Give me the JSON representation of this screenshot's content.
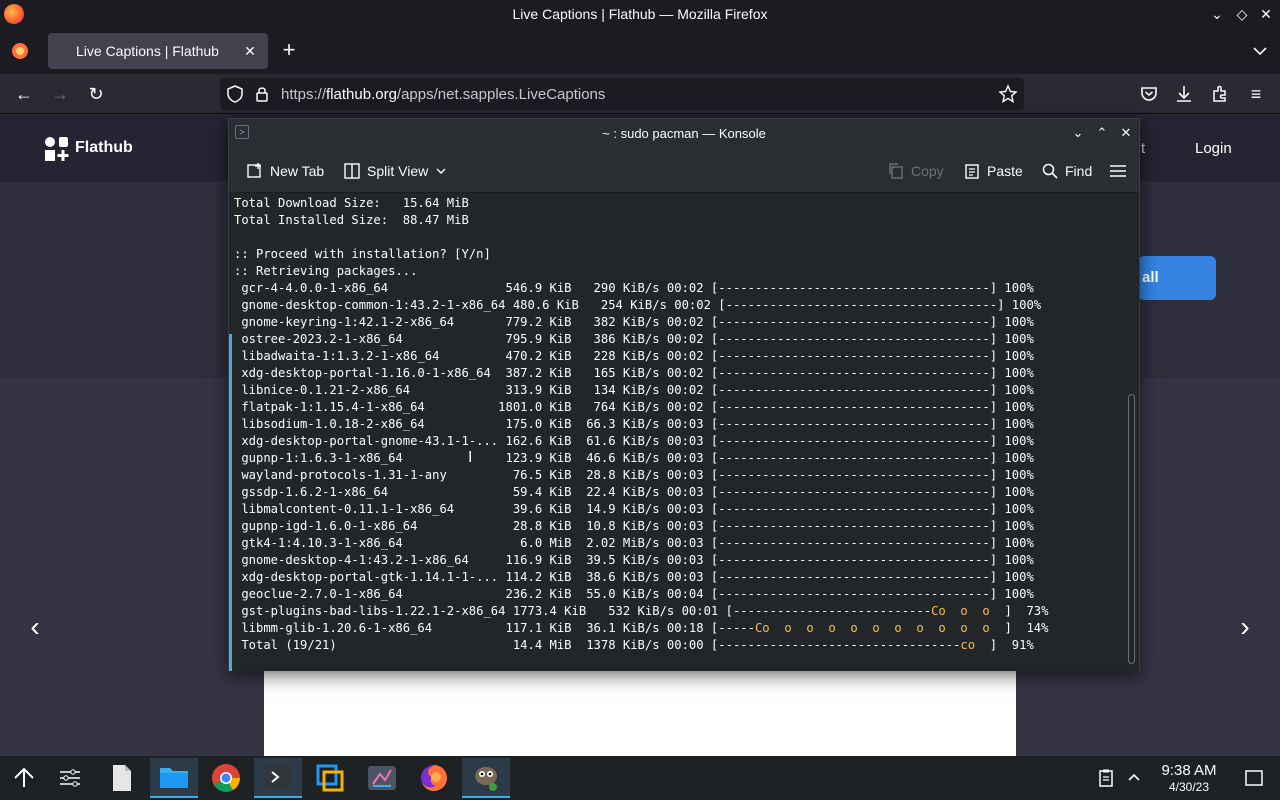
{
  "window": {
    "title": "Live Captions | Flathub — Mozilla Firefox"
  },
  "browser": {
    "tab_label": "Live Captions | Flathub",
    "url_host": "flathub.org",
    "url_prefix": "https://",
    "url_path": "/apps/net.sapples.LiveCaptions"
  },
  "flathub": {
    "logo_text": "Flathub",
    "nav_partial": "t",
    "login": "Login",
    "install_partial": "all"
  },
  "konsole": {
    "title": "~ : sudo pacman — Konsole",
    "toolbar": {
      "new_tab": "New Tab",
      "split_view": "Split View",
      "copy": "Copy",
      "paste": "Paste",
      "find": "Find"
    },
    "lines": [
      "Total Download Size:   15.64 MiB",
      "Total Installed Size:  88.47 MiB",
      "",
      ":: Proceed with installation? [Y/n]",
      ":: Retrieving packages...",
      " gcr-4-4.0.0-1-x86_64                546.9 KiB   290 KiB/s 00:02 [-------------------------------------] 100%",
      " gnome-desktop-common-1:43.2-1-x86_64 480.6 KiB   254 KiB/s 00:02 [-------------------------------------] 100%",
      " gnome-keyring-1:42.1-2-x86_64       779.2 KiB   382 KiB/s 00:02 [-------------------------------------] 100%",
      " ostree-2023.2-1-x86_64              795.9 KiB   386 KiB/s 00:02 [-------------------------------------] 100%",
      " libadwaita-1:1.3.2-1-x86_64         470.2 KiB   228 KiB/s 00:02 [-------------------------------------] 100%",
      " xdg-desktop-portal-1.16.0-1-x86_64  387.2 KiB   165 KiB/s 00:02 [-------------------------------------] 100%",
      " libnice-0.1.21-2-x86_64             313.9 KiB   134 KiB/s 00:02 [-------------------------------------] 100%",
      " flatpak-1:1.15.4-1-x86_64          1801.0 KiB   764 KiB/s 00:02 [-------------------------------------] 100%",
      " libsodium-1.0.18-2-x86_64           175.0 KiB  66.3 KiB/s 00:03 [-------------------------------------] 100%",
      " xdg-desktop-portal-gnome-43.1-1-... 162.6 KiB  61.6 KiB/s 00:03 [-------------------------------------] 100%",
      " gupnp-1:1.6.3-1-x86_64              123.9 KiB  46.6 KiB/s 00:03 [-------------------------------------] 100%",
      " wayland-protocols-1.31-1-any         76.5 KiB  28.8 KiB/s 00:03 [-------------------------------------] 100%",
      " gssdp-1.6.2-1-x86_64                 59.4 KiB  22.4 KiB/s 00:03 [-------------------------------------] 100%",
      " libmalcontent-0.11.1-1-x86_64        39.6 KiB  14.9 KiB/s 00:03 [-------------------------------------] 100%",
      " gupnp-igd-1.6.0-1-x86_64             28.8 KiB  10.8 KiB/s 00:03 [-------------------------------------] 100%",
      " gtk4-1:4.10.3-1-x86_64                6.0 MiB  2.02 MiB/s 00:03 [-------------------------------------] 100%",
      " gnome-desktop-4-1:43.2-1-x86_64     116.9 KiB  39.5 KiB/s 00:03 [-------------------------------------] 100%",
      " xdg-desktop-portal-gtk-1.14.1-1-... 114.2 KiB  38.6 KiB/s 00:03 [-------------------------------------] 100%",
      " geoclue-2.7.0-1-x86_64              236.2 KiB  55.0 KiB/s 00:04 [-------------------------------------] 100%",
      " gst-plugins-bad-libs-1.22.1-2-x86_64 1773.4 KiB   532 KiB/s 00:01 [---------------------------Co  o  o  ]  73%",
      " libmm-glib-1.20.6-1-x86_64          117.1 KiB  36.1 KiB/s 00:18 [-----Co  o  o  o  o  o  o  o  o  o  o  ]  14%",
      " Total (19/21)                        14.4 MiB  1378 KiB/s 00:00 [---------------------------------co  ]  91%"
    ]
  },
  "taskbar": {
    "time": "9:38 AM",
    "date": "4/30/23"
  },
  "colors": {
    "konsole_accent": "#3daee9",
    "pacman_progress": "#fdbc4b",
    "flathub_button": "#3584e4"
  }
}
